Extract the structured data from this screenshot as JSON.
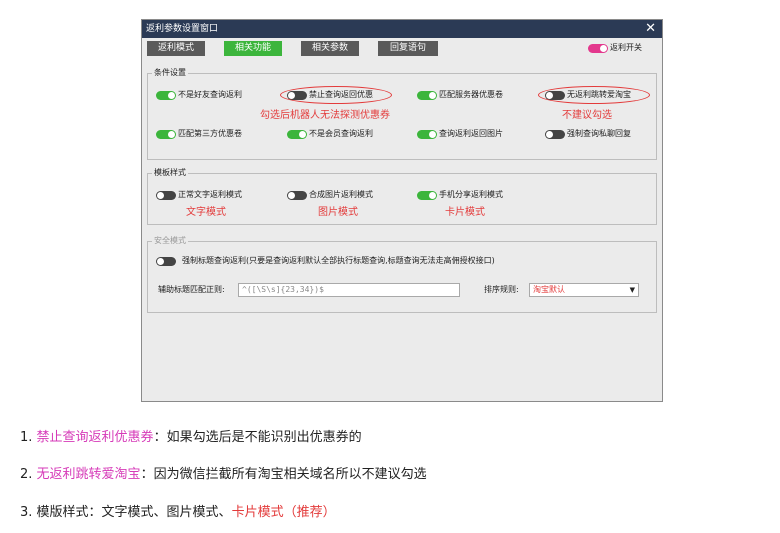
{
  "window": {
    "title": "返利参数设置窗口",
    "close_glyph": "✕",
    "tabs": [
      "返利模式",
      "相关功能",
      "相关参数",
      "回复语句"
    ],
    "active_tab": "相关功能",
    "master_switch_label": "返利开关"
  },
  "conditions": {
    "group_label": "条件设置",
    "options": [
      {
        "label": "不是好友查询返利",
        "state": "on"
      },
      {
        "label": "禁止查询返回优惠",
        "state": "off"
      },
      {
        "label": "匹配服务器优惠卷",
        "state": "on"
      },
      {
        "label": "无返利跳转爱淘宝",
        "state": "off"
      },
      {
        "label": "匹配第三方优惠卷",
        "state": "on"
      },
      {
        "label": "不是会员查询返利",
        "state": "on"
      },
      {
        "label": "查询返利返回图片",
        "state": "on"
      },
      {
        "label": "强制查询私聊回复",
        "state": "off"
      }
    ],
    "annotation_coupon": "勾选后机器人无法探测优惠券",
    "annotation_jump": "不建议勾选"
  },
  "template_style": {
    "group_label": "模板样式",
    "options": [
      {
        "label": "正常文字返利模式",
        "state": "off",
        "annotation": "文字模式"
      },
      {
        "label": "合成图片返利模式",
        "state": "off",
        "annotation": "图片模式"
      },
      {
        "label": "手机分享返利模式",
        "state": "on",
        "annotation": "卡片模式"
      }
    ]
  },
  "security": {
    "group_label": "安全模式",
    "force_title_label": "强制标题查询返利(只要是查询返利默认全部执行标题查询,标题查询无法走高佣授权接口)",
    "regex_label": "辅助标题匹配正则:",
    "regex_value": "^([\\S\\s]{23,34})$",
    "sort_label": "排序规则:",
    "sort_value": "淘宝默认"
  },
  "notes": [
    {
      "num": "1.",
      "highlight": "禁止查询返利优惠券",
      "rest": "：如果勾选后是不能识别出优惠券的"
    },
    {
      "num": "2.",
      "highlight": "无返利跳转爱淘宝",
      "rest": "：因为微信拦截所有淘宝相关域名所以不建议勾选"
    },
    {
      "num": "3.",
      "prefix": "模版样式：文字模式、图片模式、",
      "highlight": "卡片模式（推荐）"
    }
  ],
  "colors": {
    "accent_green": "#3cb53c",
    "titlebar": "#2b3a55",
    "annotation_red": "#e33b3b",
    "highlight_pink": "#d63ab8",
    "master_pink": "#e3388d"
  }
}
